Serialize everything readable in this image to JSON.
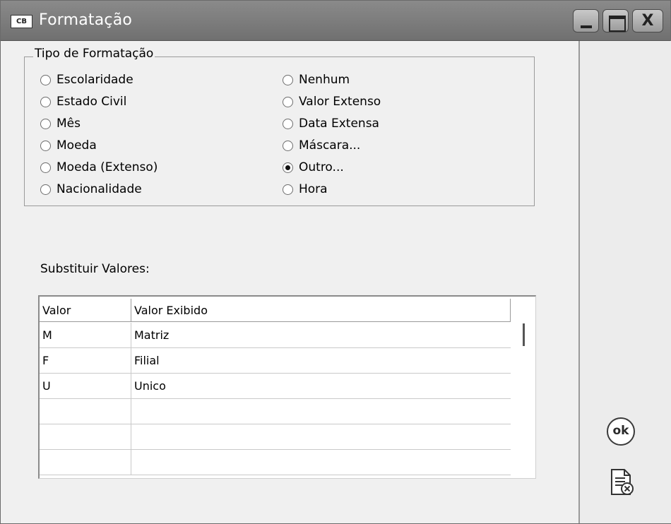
{
  "window": {
    "icon_text": "CB",
    "title": "Formatação",
    "minimize_icon": "minimize-icon",
    "maximize_icon": "maximize-icon",
    "close_icon": "close-icon"
  },
  "tipo": {
    "legend": "Tipo de Formatação",
    "options_left": [
      "Escolaridade",
      "Estado Civil",
      "Mês",
      "Moeda",
      "Moeda (Extenso)",
      "Nacionalidade"
    ],
    "options_right": [
      "Nenhum",
      "Valor Extenso",
      "Data Extensa",
      "Máscara...",
      "Outro...",
      "Hora"
    ],
    "selected": "Outro..."
  },
  "substituir": {
    "label": "Substituir Valores:",
    "columns": [
      "Valor",
      "Valor Exibido"
    ],
    "rows": [
      [
        "M",
        "Matriz"
      ],
      [
        "F",
        "Filial"
      ],
      [
        "U",
        "Unico"
      ],
      [
        "",
        ""
      ],
      [
        "",
        ""
      ],
      [
        "",
        ""
      ]
    ]
  },
  "actions": {
    "ok_label": "ok",
    "cancel_icon": "document-cancel-icon"
  }
}
